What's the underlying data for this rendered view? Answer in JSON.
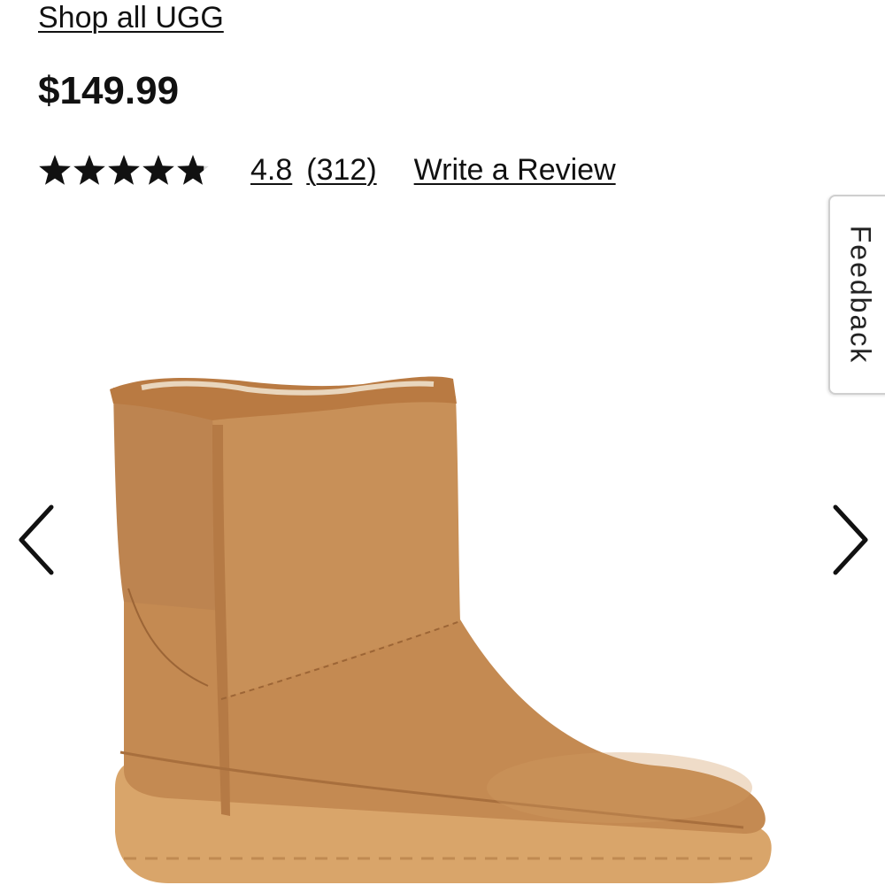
{
  "product": {
    "brand_link": "Shop all UGG",
    "price": "$149.99"
  },
  "rating": {
    "value": 4.8,
    "max": 5,
    "value_text": "4.8",
    "count_text": "(312)",
    "write_review": "Write a Review"
  },
  "feedback": {
    "label": "Feedback"
  },
  "carousel": {
    "prev_icon": "chevron-left-icon",
    "next_icon": "chevron-right-icon",
    "image_subject": "chestnut suede ankle boot"
  },
  "colors": {
    "boot_suede": "#c48a52",
    "boot_trim": "#b97a42",
    "sole": "#d9a56a",
    "text": "#111111"
  }
}
